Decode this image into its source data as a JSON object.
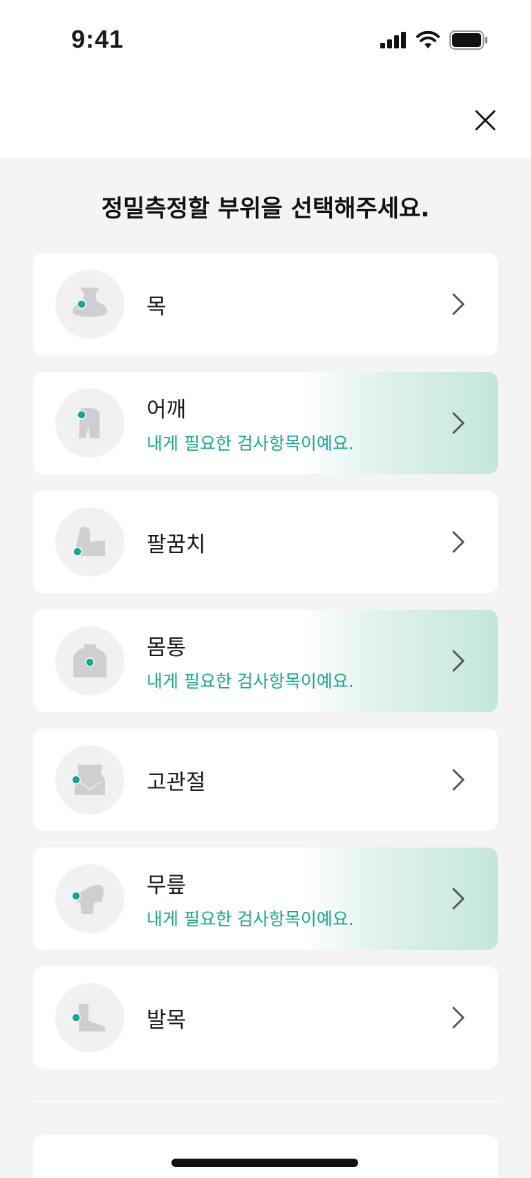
{
  "status_bar": {
    "time": "9:41"
  },
  "page": {
    "title": "정밀측정할 부위을 선택해주세요."
  },
  "body_parts": [
    {
      "label": "목",
      "recommended": false,
      "subtitle": ""
    },
    {
      "label": "어깨",
      "recommended": true,
      "subtitle": "내게 필요한 검사항목이예요."
    },
    {
      "label": "팔꿈치",
      "recommended": false,
      "subtitle": ""
    },
    {
      "label": "몸통",
      "recommended": true,
      "subtitle": "내게 필요한 검사항목이예요."
    },
    {
      "label": "고관절",
      "recommended": false,
      "subtitle": ""
    },
    {
      "label": "무릎",
      "recommended": true,
      "subtitle": "내게 필요한 검사항목이예요."
    },
    {
      "label": "발목",
      "recommended": false,
      "subtitle": ""
    }
  ],
  "bottom_card": {
    "label": ""
  },
  "colors": {
    "accent": "#19a68e",
    "background": "#f4f4f4",
    "card": "#ffffff",
    "recommended_gradient": "#c4e6dd"
  },
  "icons": [
    "signal-icon",
    "wifi-icon",
    "battery-icon",
    "close-icon",
    "neck-icon",
    "shoulder-icon",
    "elbow-icon",
    "torso-icon",
    "hip-icon",
    "knee-icon",
    "ankle-icon",
    "chevron-right-icon"
  ]
}
